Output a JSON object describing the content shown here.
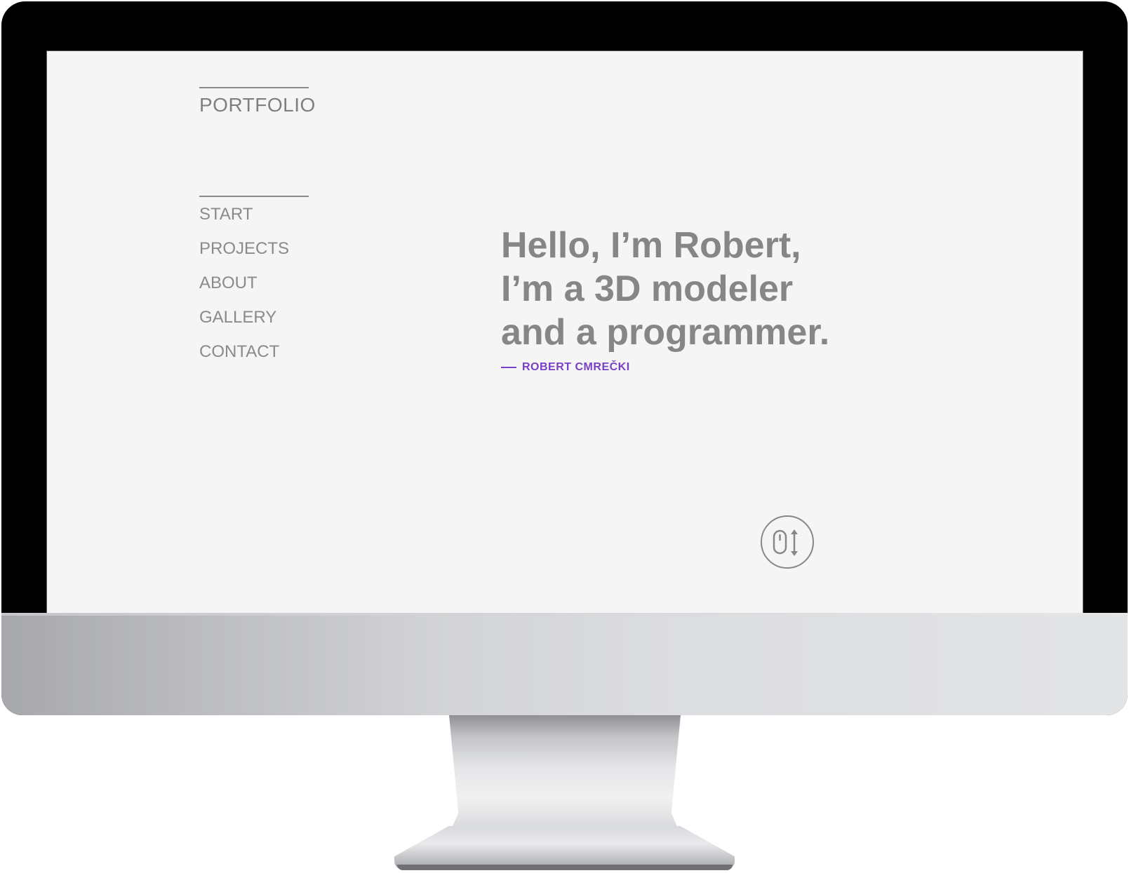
{
  "brand": {
    "logo": "PORTFOLIO"
  },
  "nav": {
    "items": [
      {
        "label": "START"
      },
      {
        "label": "PROJECTS"
      },
      {
        "label": "ABOUT"
      },
      {
        "label": "GALLERY"
      },
      {
        "label": "CONTACT"
      }
    ]
  },
  "hero": {
    "lines": [
      "Hello, I’m Robert,",
      "I’m a 3D modeler",
      "and a programmer."
    ],
    "author": "ROBERT CMREČKI"
  },
  "scroll": {
    "icon": "mouse-scroll-icon"
  },
  "colors": {
    "page_bg": "#f5f5f5",
    "text_gray": "#868686",
    "accent": "#7a3fc7",
    "bezel": "#000000"
  }
}
